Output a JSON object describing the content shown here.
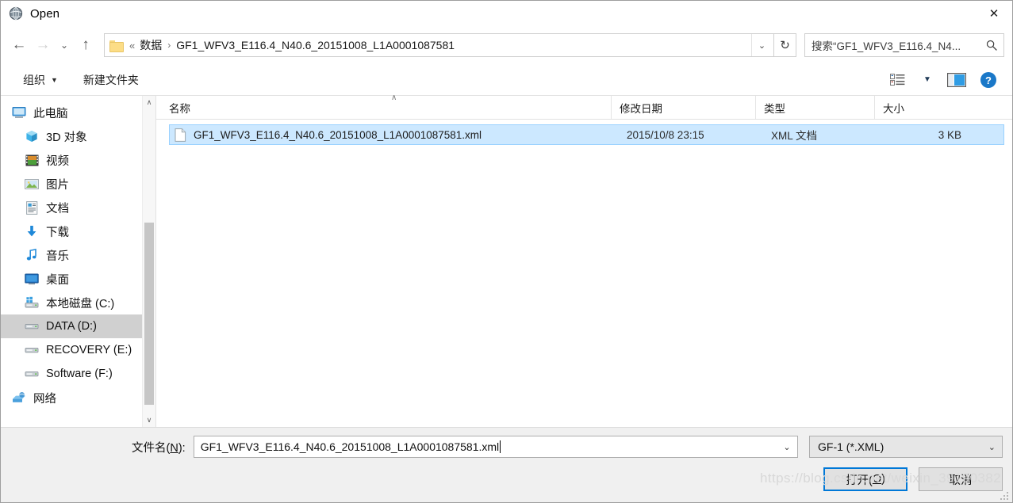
{
  "window": {
    "title": "Open",
    "icon": "app-globe-icon",
    "close_label": "✕"
  },
  "nav": {
    "back_icon": "←",
    "forward_icon": "→",
    "recent_icon": "⌄",
    "up_icon": "↑",
    "refresh_icon": "↻",
    "dropdown_icon": "⌄"
  },
  "address": {
    "folder_icon": "folder-icon",
    "double_chevron": "«",
    "crumbs": [
      "数据",
      "GF1_WFV3_E116.4_N40.6_20151008_L1A0001087581"
    ],
    "separator": "›"
  },
  "search": {
    "text": "搜索“GF1_WFV3_E116.4_N4...",
    "icon": "search-icon"
  },
  "toolbar": {
    "organize_label": "组织",
    "organize_caret": "▼",
    "new_folder_label": "新建文件夹",
    "view_icon": "view-list-icon",
    "view_caret": "▼",
    "preview_pane_icon": "preview-pane-icon",
    "help_icon": "?"
  },
  "sidebar": {
    "items": [
      {
        "label": "此电脑",
        "icon": "monitor-icon",
        "indent": false,
        "selected": false
      },
      {
        "label": "3D 对象",
        "icon": "cube-icon",
        "indent": true,
        "selected": false
      },
      {
        "label": "视频",
        "icon": "video-icon",
        "indent": true,
        "selected": false
      },
      {
        "label": "图片",
        "icon": "picture-icon",
        "indent": true,
        "selected": false
      },
      {
        "label": "文档",
        "icon": "document-icon",
        "indent": true,
        "selected": false
      },
      {
        "label": "下载",
        "icon": "download-icon",
        "indent": true,
        "selected": false
      },
      {
        "label": "音乐",
        "icon": "music-icon",
        "indent": true,
        "selected": false
      },
      {
        "label": "桌面",
        "icon": "desktop-icon",
        "indent": true,
        "selected": false
      },
      {
        "label": "本地磁盘 (C:)",
        "icon": "windows-drive-icon",
        "indent": true,
        "selected": false
      },
      {
        "label": "DATA (D:)",
        "icon": "drive-icon",
        "indent": true,
        "selected": true
      },
      {
        "label": "RECOVERY (E:)",
        "icon": "drive-icon",
        "indent": true,
        "selected": false
      },
      {
        "label": "Software (F:)",
        "icon": "drive-icon",
        "indent": true,
        "selected": false
      },
      {
        "label": "网络",
        "icon": "network-icon",
        "indent": false,
        "selected": false
      }
    ],
    "scroll_up_icon": "∧",
    "scroll_down_icon": "∨"
  },
  "filelist": {
    "columns": [
      {
        "label": "名称",
        "key": "name"
      },
      {
        "label": "修改日期",
        "key": "date"
      },
      {
        "label": "类型",
        "key": "type"
      },
      {
        "label": "大小",
        "key": "size"
      }
    ],
    "sort_caret": "∧",
    "rows": [
      {
        "name": "GF1_WFV3_E116.4_N40.6_20151008_L1A0001087581.xml",
        "date": "2015/10/8 23:15",
        "type": "XML 文档",
        "size": "3 KB",
        "icon": "xml-file-icon",
        "selected": true
      }
    ]
  },
  "footer": {
    "filename_label_prefix": "文件名(",
    "filename_label_accel": "N",
    "filename_label_suffix": "):",
    "filename_value": "GF1_WFV3_E116.4_N40.6_20151008_L1A0001087581.xml",
    "filename_placeholder": "文件名",
    "filetype_value": "GF-1 (*.XML)",
    "filetype_caret": "⌄",
    "open_prefix": "打开(",
    "open_accel": "O",
    "open_suffix": ")",
    "cancel_label": "取消",
    "watermark": "https://blog.csdn.net/weixin_39190382"
  },
  "colors": {
    "accent": "#0078d7",
    "selection": "#cce8ff",
    "selection_border": "#99d1ff",
    "sidebar_selected": "#d0d0d0",
    "footer_bg": "#f0f0f0",
    "folder_yellow": "#fcdd86"
  }
}
